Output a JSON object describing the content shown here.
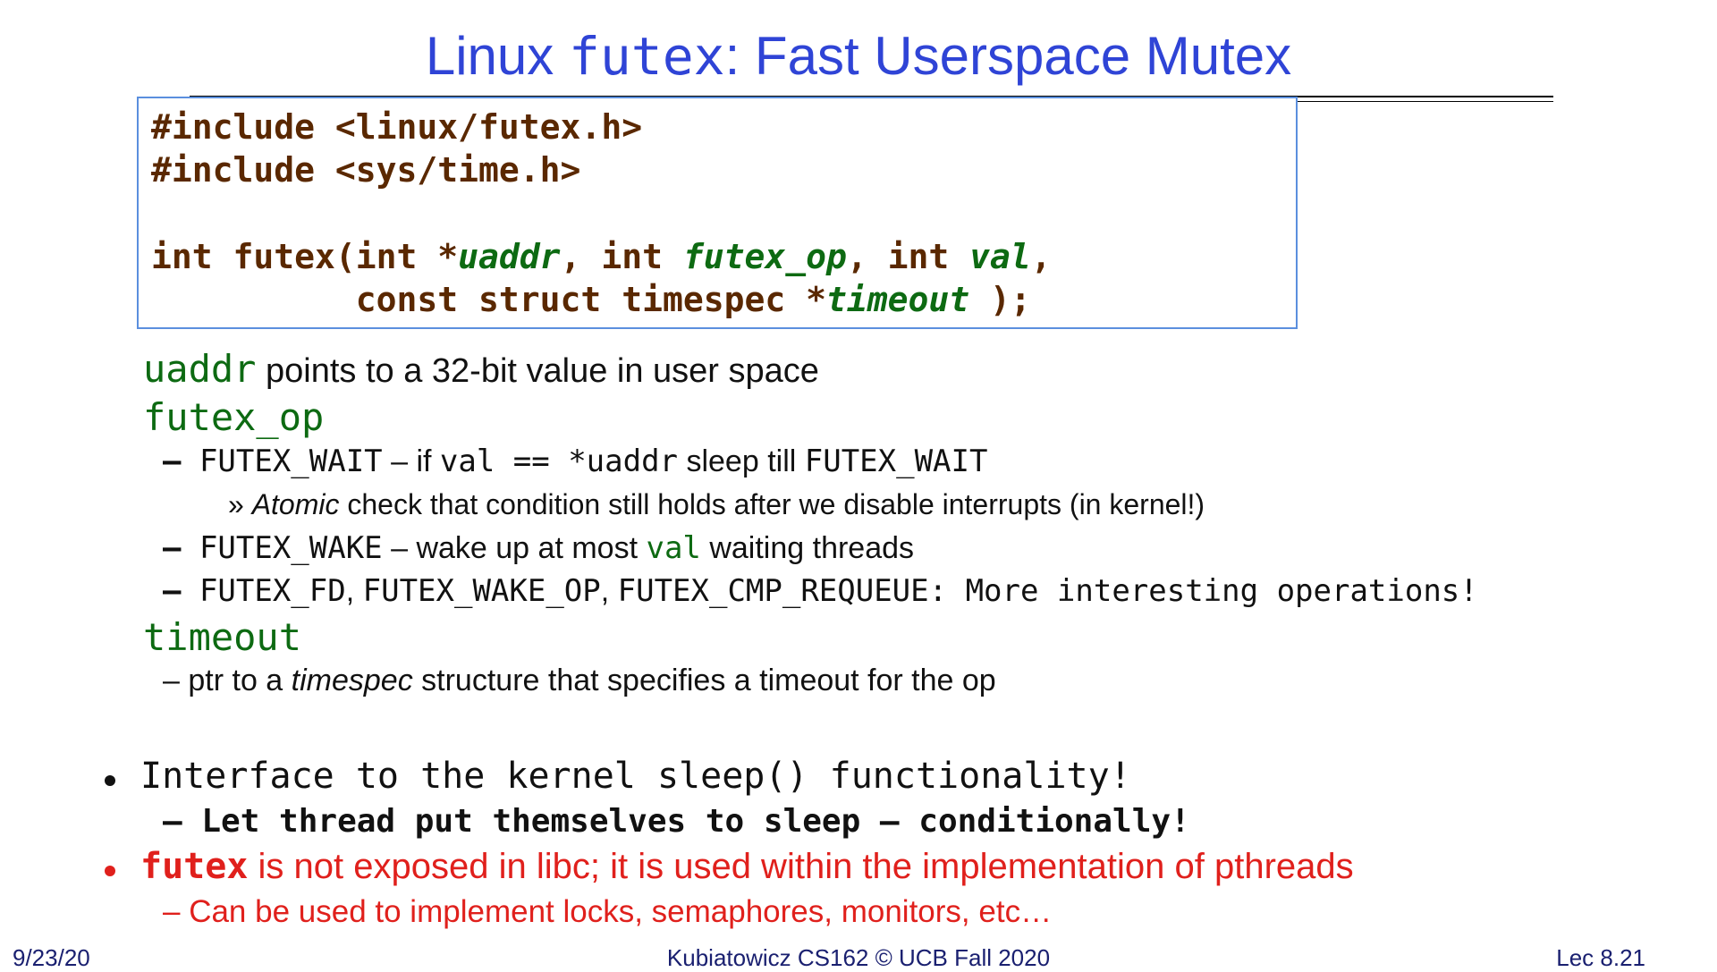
{
  "title": {
    "prefix": "Linux ",
    "code": "futex",
    "suffix": ": Fast Userspace Mutex"
  },
  "code": {
    "line1": "#include <linux/futex.h>",
    "line2": "#include <sys/time.h>",
    "sig_int1": "int futex(int *",
    "sig_uaddr": "uaddr",
    "sig_int2": ", int ",
    "sig_futex_op": "futex_op",
    "sig_int3": ", int ",
    "sig_val": "val",
    "sig_end1": ",",
    "sig_const": "          const struct timespec *",
    "sig_timeout": "timeout",
    "sig_end2": " );"
  },
  "params": {
    "uaddr": {
      "name": "uaddr",
      "desc": " points to a 32-bit value in user space"
    },
    "futex_op": {
      "name": "futex_op"
    },
    "wait": {
      "dash": "– ",
      "name": "FUTEX_WAIT",
      "sep": " – if ",
      "cond": "val == *uaddr",
      "mid": " sleep till ",
      "name2": "FUTEX_WAIT"
    },
    "wait_sub": {
      "mark": "»",
      "atomic": "Atomic",
      "rest": " check that condition still holds after we disable interrupts (in kernel!)"
    },
    "wake": {
      "dash": "– ",
      "name": "FUTEX_WAKE",
      "mid": " – wake up at most ",
      "val": "val",
      "rest": " waiting threads"
    },
    "more": {
      "dash": "– ",
      "fd": "FUTEX_FD",
      "c1": ", ",
      "wake_op": "FUTEX_WAKE_OP",
      "c2": ", ",
      "cmp": "FUTEX_CMP_REQUEUE",
      "rest": ": More interesting operations!"
    },
    "timeout": {
      "name": "timeout"
    },
    "timeout_desc": {
      "dash": "–",
      "pre": " ptr to a ",
      "italic": "timespec",
      "post": " structure that specifies a timeout for the op"
    }
  },
  "bullets": {
    "b1": "Interface to the kernel sleep() functionality!",
    "b1_sub": "– Let thread put themselves to sleep – conditionally!",
    "b2_code": "futex",
    "b2_text": " is not exposed in libc; it is used within the implementation of pthreads",
    "b2_sub": "– Can be used to implement locks, semaphores, monitors, etc…"
  },
  "footer": {
    "date": "9/23/20",
    "center": "Kubiatowicz CS162 © UCB Fall 2020",
    "lec": "Lec 8.21"
  },
  "colors": {
    "title": "#2f44d6",
    "code": "#5a2800",
    "param": "#0d6a12",
    "alert": "#e0201c",
    "box": "#5b8fde"
  }
}
